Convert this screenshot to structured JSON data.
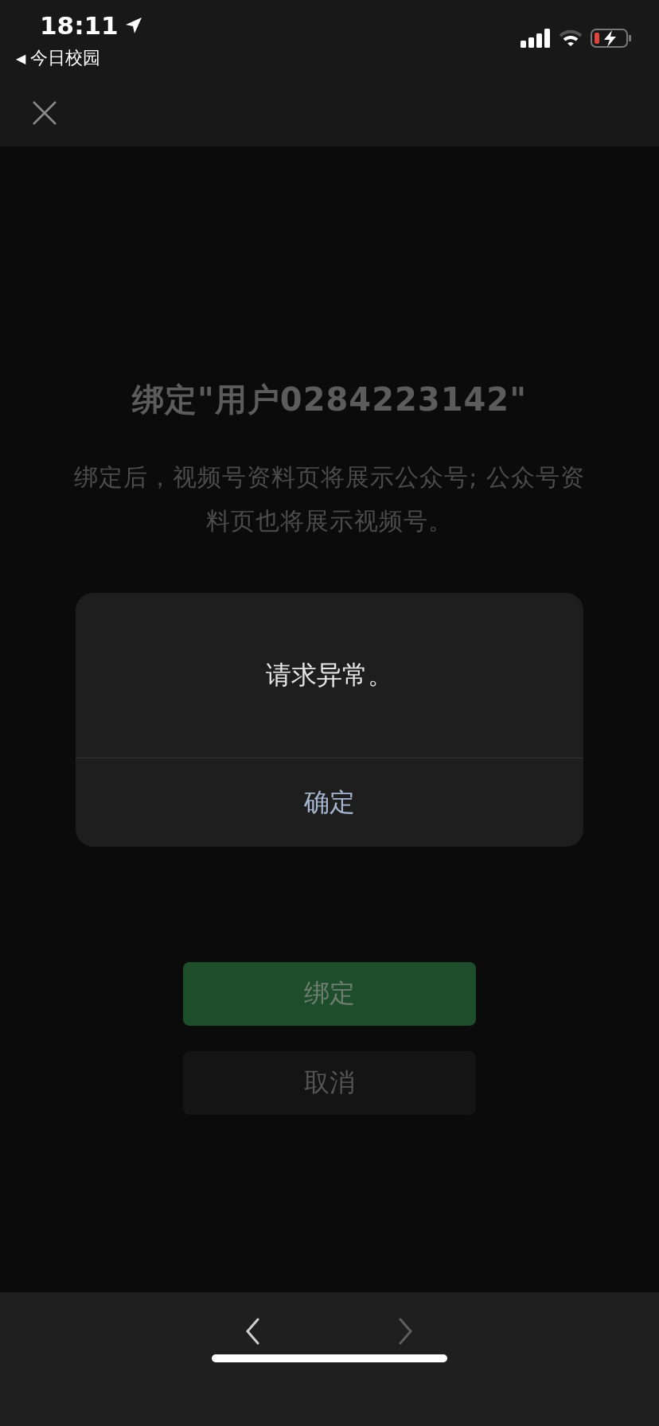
{
  "status_bar": {
    "time": "18:11",
    "back_glyph": "◀",
    "back_app": "今日校园"
  },
  "page": {
    "title": "绑定\"用户0284223142\"",
    "description": "绑定后，视频号资料页将展示公众号; 公众号资料页也将展示视频号。",
    "buttons": [
      {
        "label": "绑定",
        "kind": "primary"
      },
      {
        "label": "取消",
        "kind": "secondary"
      }
    ]
  },
  "dialog": {
    "message": "请求异常。",
    "button": "确定"
  },
  "nav": [
    {
      "kind": "back",
      "disabled": false
    },
    {
      "kind": "forward",
      "disabled": true
    }
  ]
}
